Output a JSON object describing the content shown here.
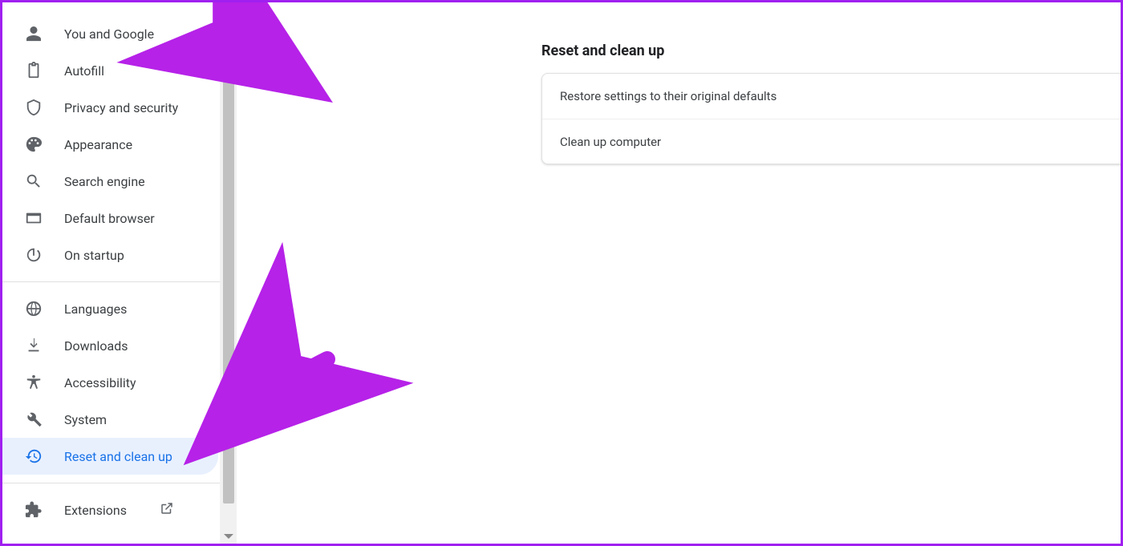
{
  "sidebar": {
    "items": [
      {
        "label": "You and Google",
        "icon": "person",
        "name": "sidebar-item-you-and-google"
      },
      {
        "label": "Autofill",
        "icon": "clipboard",
        "name": "sidebar-item-autofill"
      },
      {
        "label": "Privacy and security",
        "icon": "shield",
        "name": "sidebar-item-privacy-security"
      },
      {
        "label": "Appearance",
        "icon": "palette",
        "name": "sidebar-item-appearance"
      },
      {
        "label": "Search engine",
        "icon": "search",
        "name": "sidebar-item-search-engine"
      },
      {
        "label": "Default browser",
        "icon": "browser",
        "name": "sidebar-item-default-browser"
      },
      {
        "label": "On startup",
        "icon": "power",
        "name": "sidebar-item-on-startup"
      }
    ],
    "advanced_items": [
      {
        "label": "Languages",
        "icon": "globe",
        "name": "sidebar-item-languages"
      },
      {
        "label": "Downloads",
        "icon": "download",
        "name": "sidebar-item-downloads"
      },
      {
        "label": "Accessibility",
        "icon": "accessibility",
        "name": "sidebar-item-accessibility"
      },
      {
        "label": "System",
        "icon": "wrench",
        "name": "sidebar-item-system"
      },
      {
        "label": "Reset and clean up",
        "icon": "history",
        "name": "sidebar-item-reset-clean-up",
        "active": true
      }
    ],
    "extensions": {
      "label": "Extensions"
    }
  },
  "main": {
    "section_title": "Reset and clean up",
    "rows": [
      {
        "label": "Restore settings to their original defaults",
        "name": "row-restore-defaults"
      },
      {
        "label": "Clean up computer",
        "name": "row-clean-up-computer"
      }
    ]
  },
  "annotations": {
    "arrow_color": "#b622e8"
  }
}
